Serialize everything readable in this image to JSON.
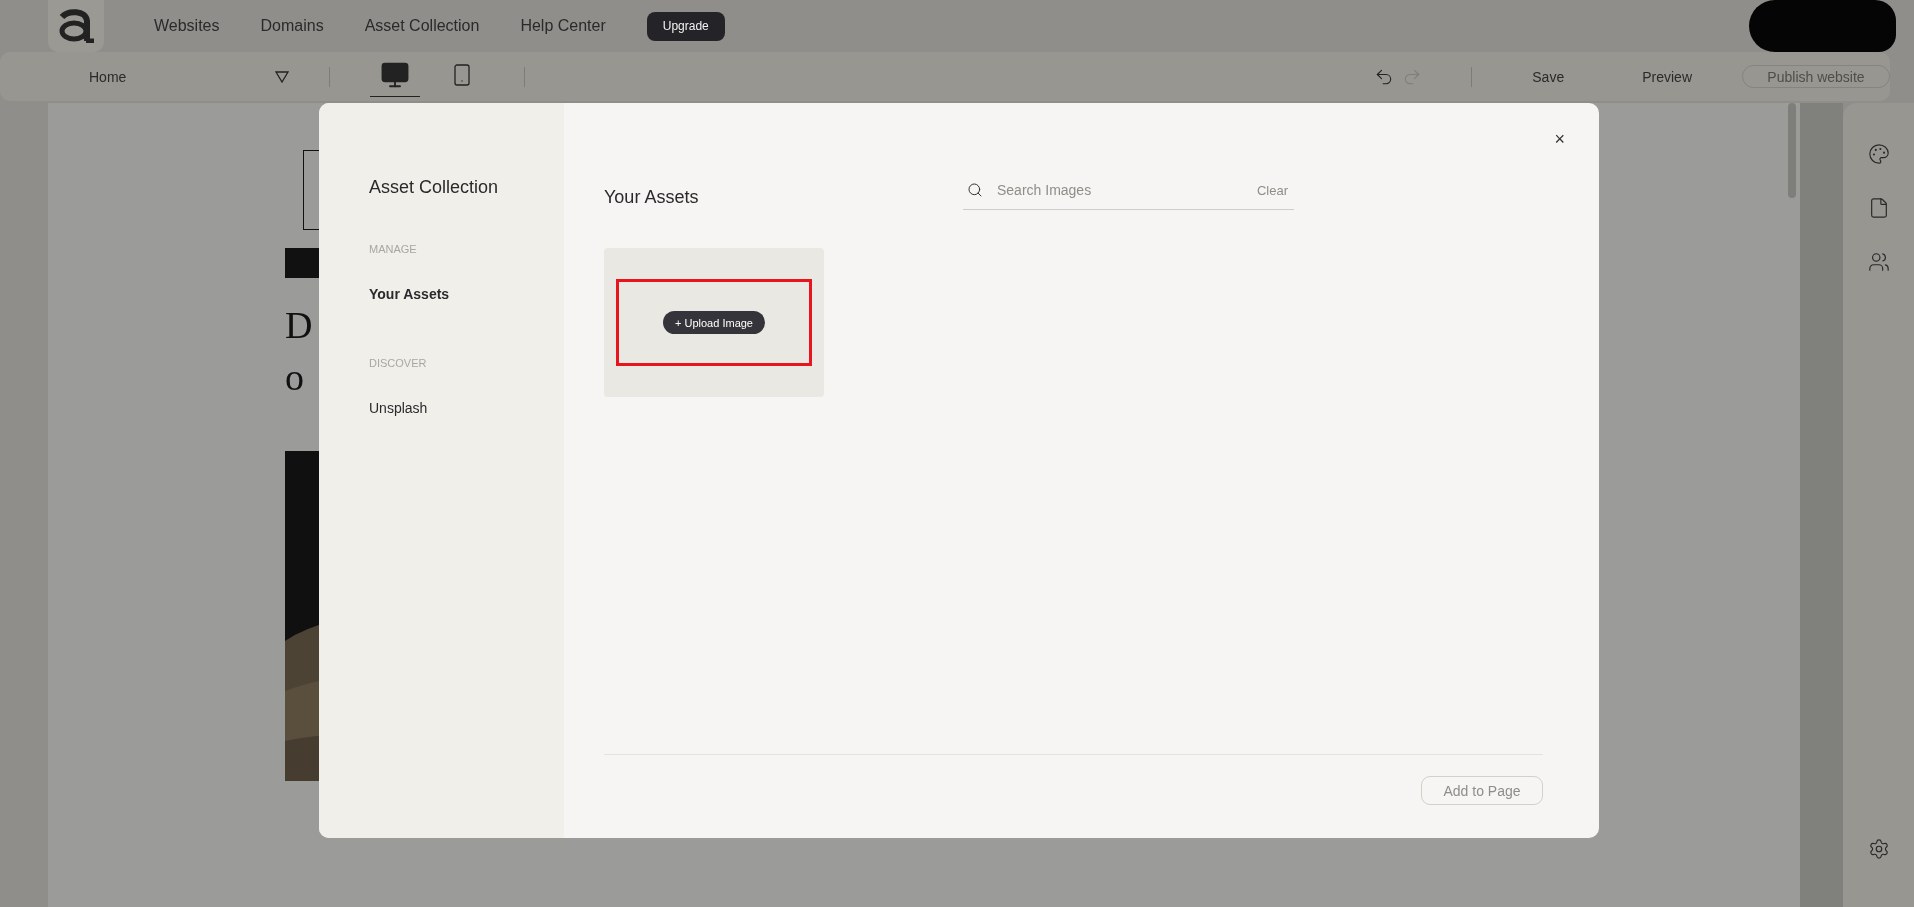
{
  "top_nav": {
    "nav_items": [
      {
        "label": "Websites"
      },
      {
        "label": "Domains"
      },
      {
        "label": "Asset Collection"
      },
      {
        "label": "Help Center"
      }
    ],
    "upgrade": "Upgrade"
  },
  "toolbar": {
    "page_select": "Home",
    "devices": [
      {
        "kind": "desktop",
        "selected": true
      },
      {
        "kind": "mobile",
        "selected": false
      }
    ],
    "undo": {
      "disabled": false
    },
    "redo": {
      "disabled": true
    },
    "save": "Save",
    "preview": "Preview",
    "publish": {
      "label": "Publish website",
      "disabled": true
    }
  },
  "canvas": {
    "heading_lines": [
      "D",
      "o"
    ]
  },
  "modal": {
    "title": "Asset Collection",
    "close": "×",
    "sections": [
      {
        "heading": "MANAGE",
        "items": [
          {
            "label": "Your Assets",
            "selected": true
          }
        ]
      },
      {
        "heading": "DISCOVER",
        "items": [
          {
            "label": "Unsplash",
            "selected": false
          }
        ]
      }
    ],
    "content_title": "Your Assets",
    "search": {
      "placeholder": "Search Images",
      "clear": "Clear"
    },
    "upload": {
      "label": "+ Upload Image",
      "highlighted": true
    },
    "add_button": {
      "label": "Add to Page",
      "disabled": true
    }
  }
}
